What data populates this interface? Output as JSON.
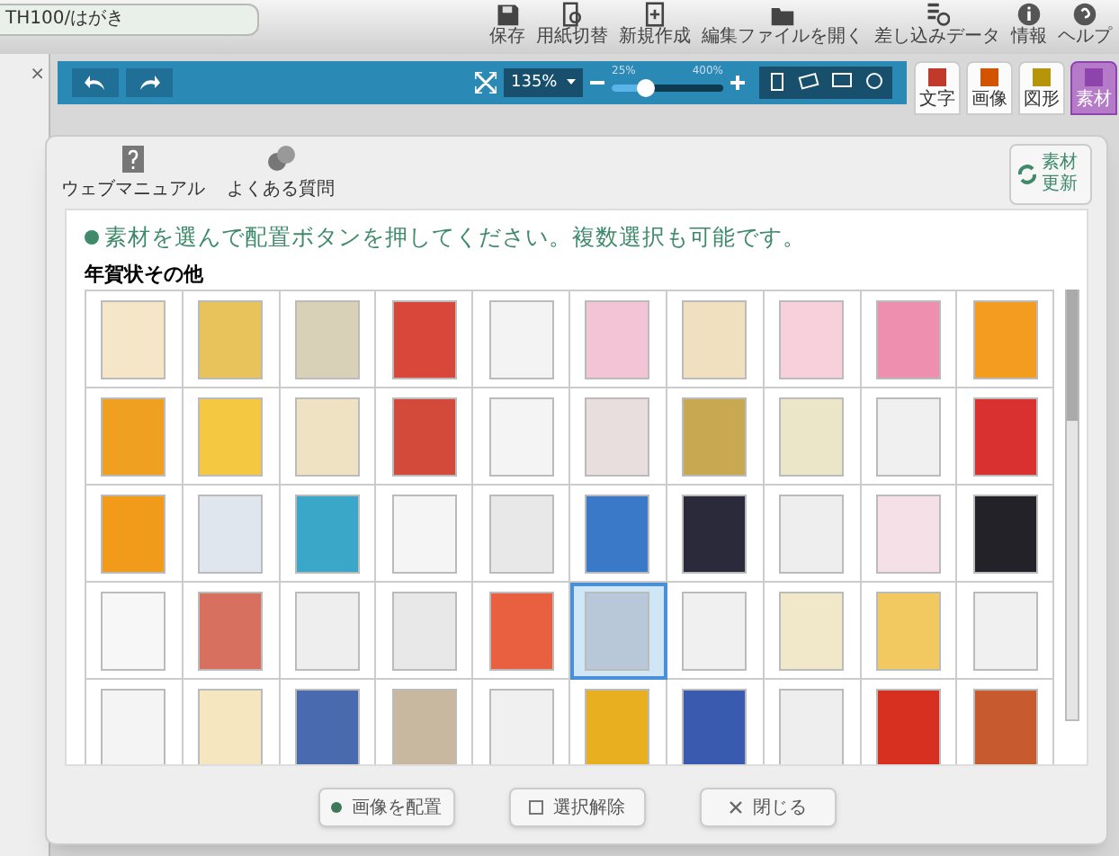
{
  "app": {
    "document_title": "TH100/はがき",
    "toolbar": [
      {
        "label": "保存"
      },
      {
        "label": "用紙切替"
      },
      {
        "label": "新規作成"
      },
      {
        "label": "編集ファイルを開く"
      },
      {
        "label": "差し込みデータ"
      },
      {
        "label": "情報"
      },
      {
        "label": "ヘルプ"
      }
    ],
    "panel_close": "×",
    "zoom": {
      "value": "135%",
      "min_label": "25%",
      "max_label": "400%",
      "level": 0.3
    },
    "side_tabs": [
      {
        "label": "文字",
        "selected": false
      },
      {
        "label": "画像",
        "selected": false
      },
      {
        "label": "図形",
        "selected": false
      },
      {
        "label": "素材",
        "selected": true
      }
    ]
  },
  "dialog": {
    "help_links": [
      {
        "label": "ウェブマニュアル"
      },
      {
        "label": "よくある質問"
      }
    ],
    "refresh_button": "素材更新",
    "instruction": "素材を選んで配置ボタンを押してください。複数選択も可能です。",
    "category": "年賀状その他",
    "thumbnails": [
      {
        "selected": false
      },
      {
        "selected": false
      },
      {
        "selected": false
      },
      {
        "selected": false
      },
      {
        "selected": false
      },
      {
        "selected": false
      },
      {
        "selected": false
      },
      {
        "selected": false
      },
      {
        "selected": false
      },
      {
        "selected": false
      },
      {
        "selected": false
      },
      {
        "selected": false
      },
      {
        "selected": false
      },
      {
        "selected": false
      },
      {
        "selected": false
      },
      {
        "selected": false
      },
      {
        "selected": false
      },
      {
        "selected": false
      },
      {
        "selected": false
      },
      {
        "selected": false
      },
      {
        "selected": false
      },
      {
        "selected": false
      },
      {
        "selected": false
      },
      {
        "selected": false
      },
      {
        "selected": false
      },
      {
        "selected": false
      },
      {
        "selected": false
      },
      {
        "selected": false
      },
      {
        "selected": false
      },
      {
        "selected": false
      },
      {
        "selected": false
      },
      {
        "selected": false
      },
      {
        "selected": false
      },
      {
        "selected": false
      },
      {
        "selected": false
      },
      {
        "selected": true
      },
      {
        "selected": false
      },
      {
        "selected": false
      },
      {
        "selected": false
      },
      {
        "selected": false
      },
      {
        "selected": false
      },
      {
        "selected": false
      },
      {
        "selected": false
      },
      {
        "selected": false
      },
      {
        "selected": false
      },
      {
        "selected": false
      },
      {
        "selected": false
      },
      {
        "selected": false
      },
      {
        "selected": false
      },
      {
        "selected": false
      }
    ],
    "buttons": [
      {
        "kind": "place",
        "label": "画像を配置"
      },
      {
        "kind": "deselect",
        "label": "選択解除"
      },
      {
        "kind": "close",
        "label": "閉じる"
      }
    ]
  }
}
